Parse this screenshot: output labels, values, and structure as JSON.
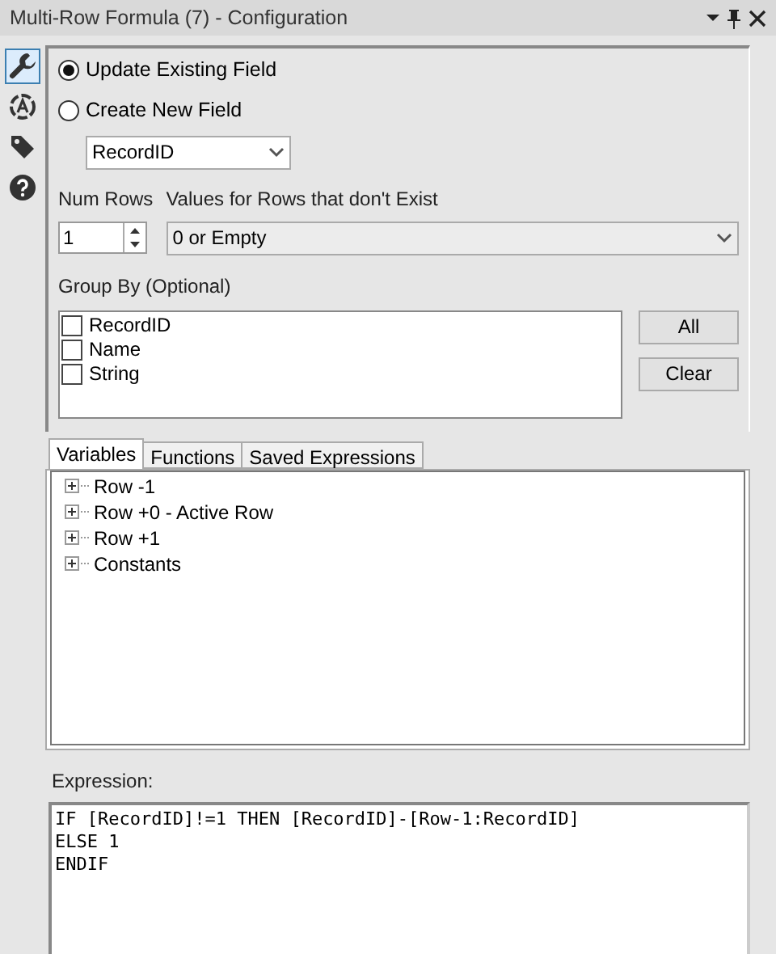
{
  "window": {
    "title": "Multi-Row Formula (7) - Configuration"
  },
  "side_tools": [
    {
      "kind": "wrench",
      "selected": true
    },
    {
      "kind": "label",
      "selected": false
    },
    {
      "kind": "tag",
      "selected": false
    },
    {
      "kind": "help",
      "selected": false
    }
  ],
  "mode_options": [
    {
      "label": "Update Existing Field",
      "selected": true
    },
    {
      "label": "Create New  Field",
      "selected": false
    }
  ],
  "field_select": {
    "value": "RecordID"
  },
  "num_rows": {
    "label": "Num Rows",
    "value": "1"
  },
  "missing_values": {
    "label": "Values for Rows that don't Exist",
    "value": "0 or Empty"
  },
  "group_by": {
    "label": "Group By (Optional)",
    "items": [
      {
        "label": "RecordID",
        "checked": false
      },
      {
        "label": "Name",
        "checked": false
      },
      {
        "label": "String",
        "checked": false
      }
    ],
    "buttons": [
      "All",
      "Clear"
    ]
  },
  "tabs": [
    {
      "label": "Variables",
      "selected": true
    },
    {
      "label": "Functions",
      "selected": false
    },
    {
      "label": "Saved Expressions",
      "selected": false
    }
  ],
  "tree": [
    {
      "label": "Row -1",
      "expanded": false
    },
    {
      "label": "Row +0 - Active Row",
      "expanded": false
    },
    {
      "label": "Row +1",
      "expanded": false
    },
    {
      "label": "Constants",
      "expanded": false
    }
  ],
  "expression": {
    "label": "Expression:",
    "value": "IF [RecordID]!=1 THEN [RecordID]-[Row-1:RecordID]\nELSE 1\nENDIF"
  }
}
